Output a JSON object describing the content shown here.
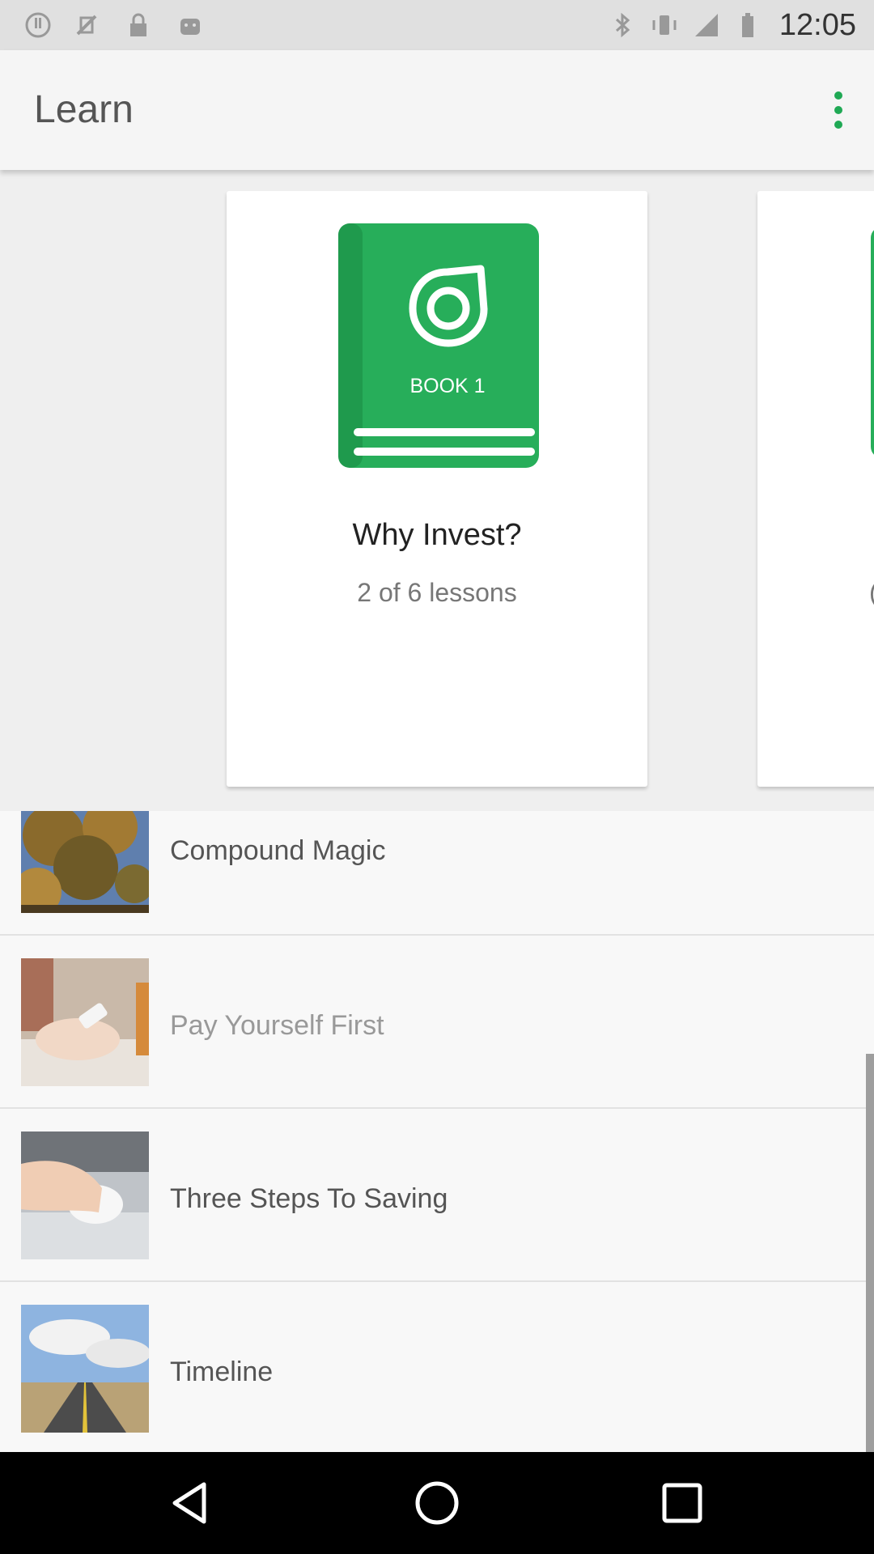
{
  "status_bar": {
    "time": "12:05",
    "icons": [
      "info-icon",
      "no-sim-icon",
      "lock-icon",
      "android-icon",
      "bluetooth-icon",
      "vibrate-icon",
      "signal-icon",
      "battery-icon"
    ]
  },
  "app_bar": {
    "title": "Learn",
    "overflow_icon": "more-vert-icon"
  },
  "colors": {
    "accent": "#20a955",
    "book_green": "#27ae5a"
  },
  "carousel": {
    "books": [
      {
        "cover_label": "BOOK 1",
        "title": "Why Invest?",
        "progress": "2 of 6 lessons"
      },
      {
        "partial_text": "("
      }
    ]
  },
  "lessons": [
    {
      "title": "Compound Magic",
      "thumb": "tree-photo"
    },
    {
      "title": "Pay Yourself First",
      "thumb": "phone-hand-photo"
    },
    {
      "title": "Three Steps To Saving",
      "thumb": "mouse-hand-photo"
    },
    {
      "title": "Timeline",
      "thumb": "road-photo"
    }
  ],
  "nav_bar": {
    "buttons": [
      "back-icon",
      "home-icon",
      "recents-icon"
    ]
  }
}
